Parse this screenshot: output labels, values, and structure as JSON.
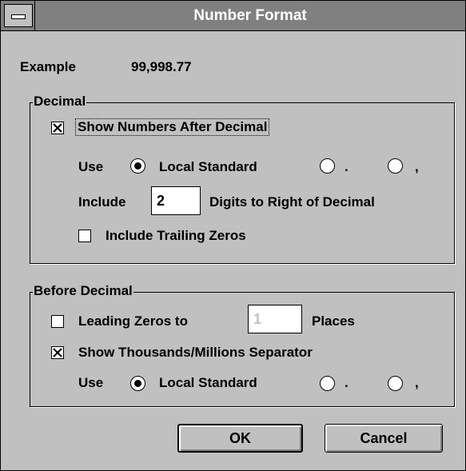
{
  "window": {
    "title": "Number Format"
  },
  "example": {
    "label": "Example",
    "value": "99,998.77"
  },
  "decimal_group": {
    "label": "Decimal",
    "show_after_decimal": {
      "label": "Show Numbers After Decimal",
      "checked": true
    },
    "use_label": "Use",
    "radios": [
      {
        "label": "Local Standard",
        "selected": true
      },
      {
        "label": ".",
        "selected": false
      },
      {
        "label": ",",
        "selected": false
      }
    ],
    "include_label": "Include",
    "digits_value": "2",
    "digits_suffix": "Digits to Right of Decimal",
    "trailing_zeros": {
      "label": "Include Trailing Zeros",
      "checked": false
    }
  },
  "before_decimal_group": {
    "label": "Before Decimal",
    "leading_zeros": {
      "label": "Leading Zeros to",
      "checked": false
    },
    "places_value": "1",
    "places_label": "Places",
    "separator": {
      "label": "Show Thousands/Millions Separator",
      "checked": true
    },
    "use_label": "Use",
    "radios": [
      {
        "label": "Local Standard",
        "selected": true
      },
      {
        "label": ".",
        "selected": false
      },
      {
        "label": ",",
        "selected": false
      }
    ]
  },
  "buttons": {
    "ok": "OK",
    "cancel": "Cancel"
  }
}
